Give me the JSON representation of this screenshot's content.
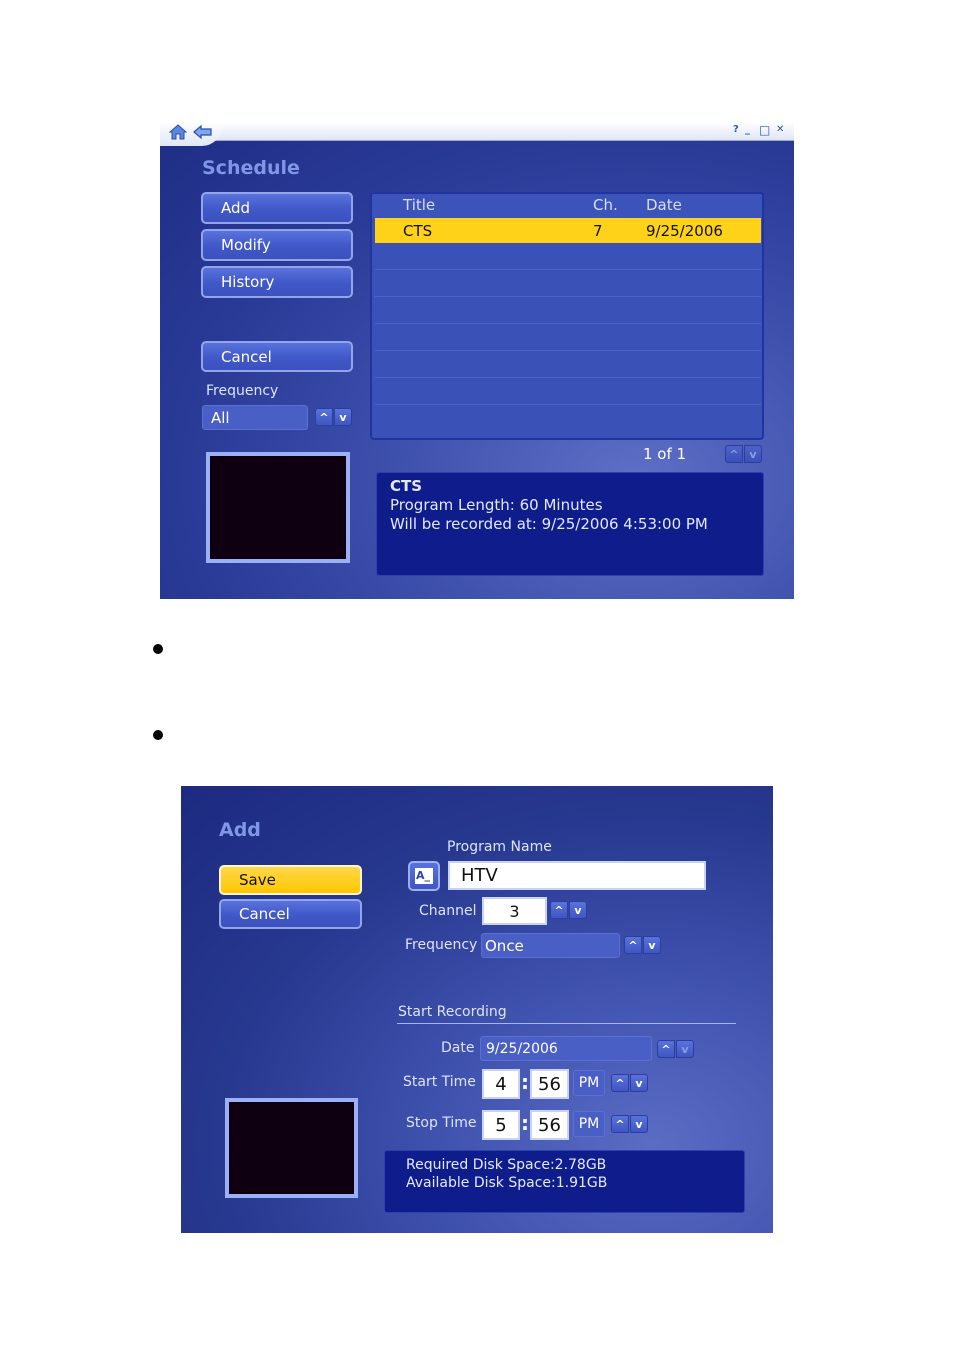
{
  "schedule_window": {
    "titlebar": {
      "home_icon": "home-icon",
      "back_icon": "back-arrow-icon",
      "help_icon": "?",
      "minimize_icon": "_",
      "maximize_icon": "□",
      "close_icon": "✕"
    },
    "title": "Schedule",
    "buttons": {
      "add": "Add",
      "modify": "Modify",
      "history": "History",
      "cancel": "Cancel"
    },
    "frequency": {
      "label": "Frequency",
      "value": "All"
    },
    "list": {
      "columns": [
        "Title",
        "Ch.",
        "Date"
      ],
      "rows": [
        {
          "title": "CTS",
          "channel": "7",
          "date": "9/25/2006",
          "selected": true
        }
      ],
      "empty_rows": 7
    },
    "pagination": "1 of 1",
    "details": {
      "title": "CTS",
      "length": "Program Length: 60 Minutes",
      "recorded_at": "Will be recorded at: 9/25/2006 4:53:00 PM"
    },
    "spin_up": "^",
    "spin_down": "v"
  },
  "add_window": {
    "title": "Add",
    "buttons": {
      "save": "Save",
      "cancel": "Cancel"
    },
    "program_name": {
      "label": "Program Name",
      "value": "HTV",
      "keyboard_icon": "A_"
    },
    "channel": {
      "label": "Channel",
      "value": "3"
    },
    "frequency": {
      "label": "Frequency",
      "value": "Once"
    },
    "start_recording": {
      "section_label": "Start Recording",
      "date_label": "Date",
      "date_value": "9/25/2006",
      "start_time_label": "Start Time",
      "start_hour": "4",
      "start_minute": "56",
      "start_ampm": "PM",
      "stop_time_label": "Stop Time",
      "stop_hour": "5",
      "stop_minute": "56",
      "stop_ampm": "PM",
      "colon": ":"
    },
    "disk": {
      "required": "Required Disk Space:2.78GB",
      "available": "Available Disk Space:1.91GB"
    }
  }
}
